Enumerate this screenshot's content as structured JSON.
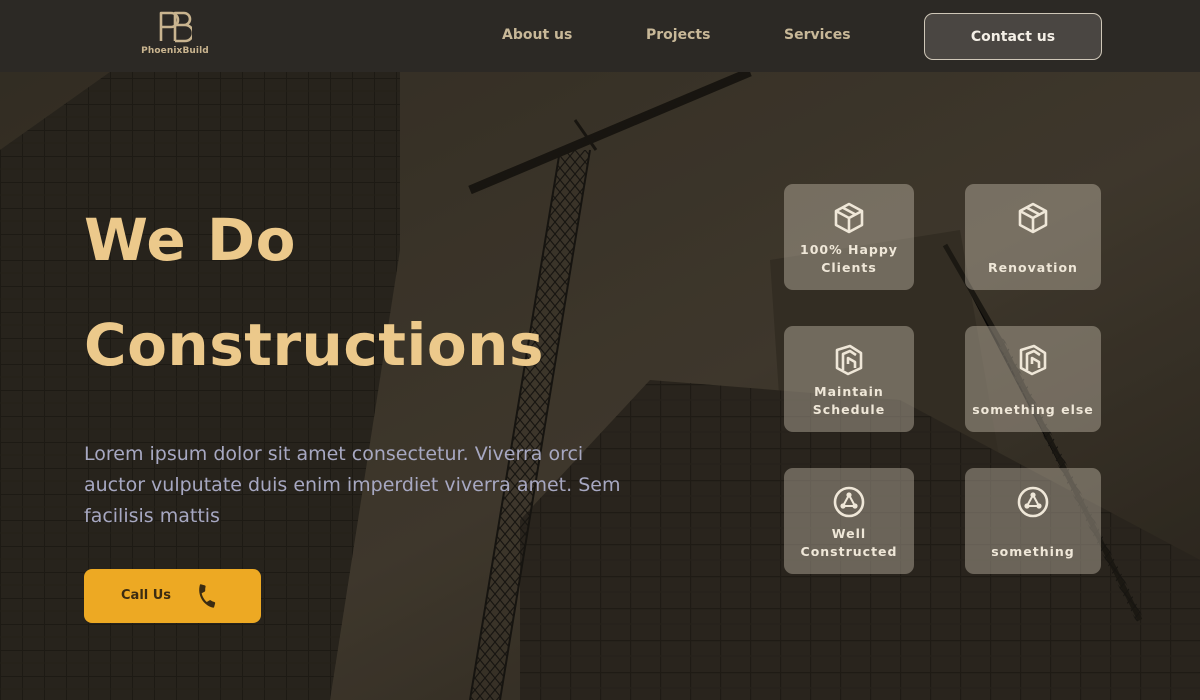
{
  "nav": {
    "brand": "PhoenixBuild",
    "links": [
      {
        "label": "About us"
      },
      {
        "label": "Projects"
      },
      {
        "label": "Services"
      }
    ],
    "contact_label": "Contact us"
  },
  "hero": {
    "headline_line1": "We Do",
    "headline_line2": "Constructions",
    "description": "Lorem ipsum dolor sit amet consectetur. Viverra orci auctor vulputate duis enim imperdiet viverra amet. Sem facilisis mattis",
    "cta_label": "Call Us"
  },
  "features": [
    {
      "line1": "100% Happy",
      "line2": "Clients",
      "icon": "cube-icon"
    },
    {
      "line1": "Renovation",
      "line2": "",
      "icon": "cube-icon"
    },
    {
      "line1": "Maintain",
      "line2": "Schedule",
      "icon": "schedule-icon"
    },
    {
      "line1": "something else",
      "line2": "",
      "icon": "schedule-icon"
    },
    {
      "line1": "Well",
      "line2": "Constructed",
      "icon": "network-icon"
    },
    {
      "line1": "something",
      "line2": "",
      "icon": "network-icon"
    }
  ],
  "colors": {
    "accent": "#eda923",
    "headline": "#ecc98b",
    "nav_bg": "#2c2925"
  }
}
